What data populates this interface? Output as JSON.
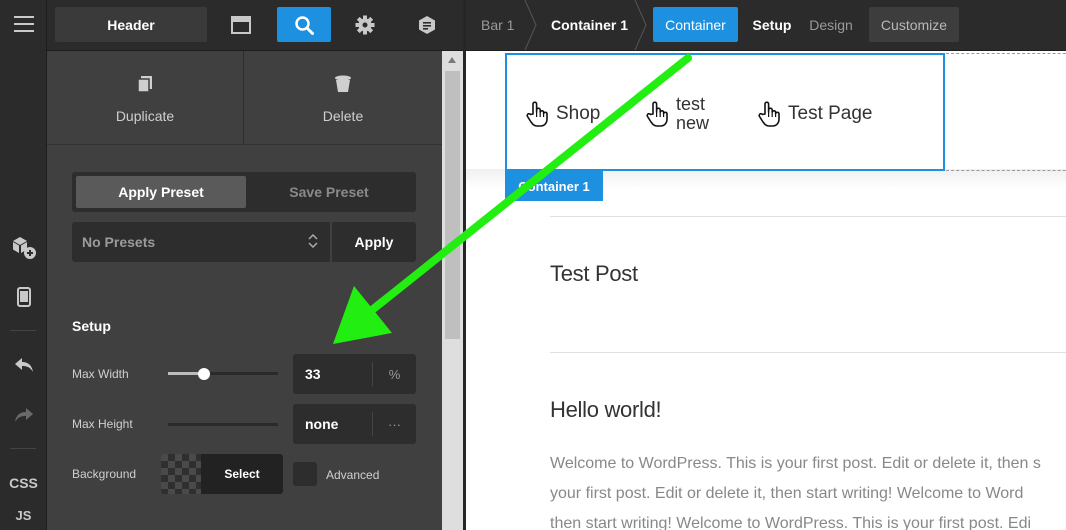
{
  "topbar": {
    "header_label": "Header",
    "icons": [
      "layout-icon",
      "search-icon",
      "gear-icon",
      "layers-icon"
    ]
  },
  "rail": {
    "items": [
      "menu-icon",
      "add-element-icon",
      "responsive-icon",
      "undo-icon",
      "redo-icon"
    ],
    "css_label": "CSS",
    "js_label": "JS"
  },
  "panel": {
    "duplicate_label": "Duplicate",
    "delete_label": "Delete",
    "apply_preset_label": "Apply Preset",
    "save_preset_label": "Save Preset",
    "preset_select_value": "No Presets",
    "apply_label": "Apply",
    "section_title": "Setup",
    "max_width_label": "Max Width",
    "max_width_value": "33",
    "max_width_unit": "%",
    "max_width_slider_fraction": 0.33,
    "max_height_label": "Max Height",
    "max_height_value": "none",
    "max_height_unit": "···",
    "background_label": "Background",
    "select_label": "Select",
    "advanced_label": "Advanced"
  },
  "breadcrumbs": {
    "items": [
      "Bar 1",
      "Container 1"
    ],
    "tabs": [
      "Container",
      "Setup",
      "Design",
      "Customize"
    ],
    "active_tab": "Container"
  },
  "preview": {
    "nav_items": [
      "Shop",
      "test new",
      "Test Page"
    ],
    "nav_item_1_line1": "test",
    "nav_item_1_line2": "new",
    "container_tag": "Container 1",
    "posts": [
      "Test Post",
      "Hello world!"
    ],
    "excerpt_lines": [
      "Welcome to WordPress. This is your first post. Edit or delete it, then s",
      "your first post. Edit or delete it, then start writing! Welcome to Word",
      "then start writing! Welcome to WordPress. This is your first post. Edi"
    ]
  },
  "colors": {
    "accent": "#1e90e0",
    "annotation_arrow": "#22ee11",
    "panel_bg": "#404040",
    "toolbar_bg": "#2b2b2b"
  }
}
